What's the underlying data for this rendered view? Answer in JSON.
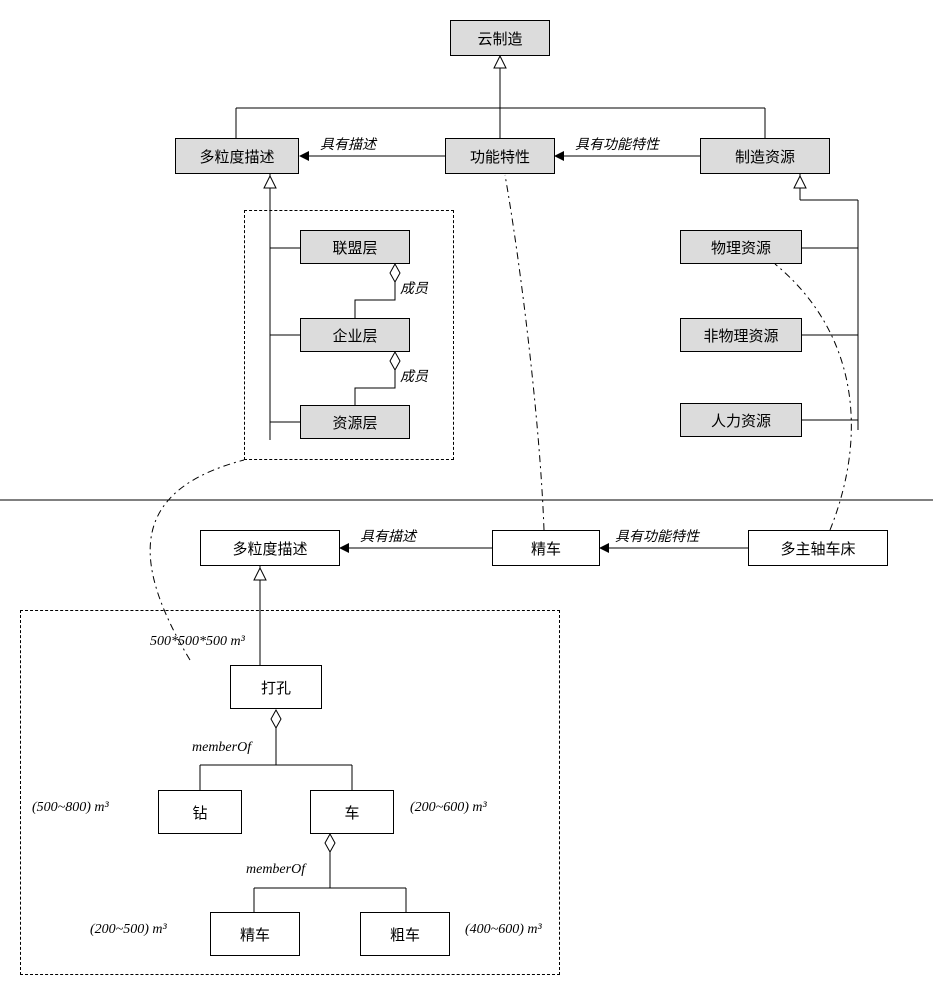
{
  "top": {
    "root": "云制造",
    "multiGran": "多粒度描述",
    "funcChar": "功能特性",
    "mfgRes": "制造资源",
    "r1_hasDesc": "具有描述",
    "r2_hasFunc": "具有功能特性",
    "layers": {
      "alliance": "联盟层",
      "enterprise": "企业层",
      "resource": "资源层",
      "member": "成员"
    },
    "resTypes": {
      "physical": "物理资源",
      "nonphysical": "非物理资源",
      "human": "人力资源"
    }
  },
  "bottom": {
    "multiGran": "多粒度描述",
    "fineTurn": "精车",
    "multiSpindle": "多主轴车床",
    "r_hasDesc": "具有描述",
    "r_hasFunc": "具有功能特性",
    "tree": {
      "drill": "打孔",
      "drillSpec": "500*500*500 m³",
      "memberOf": "memberOf",
      "boreDrill": "钻",
      "turn": "车",
      "boreSpec": "(500~800) m³",
      "turnSpec": "(200~600) m³",
      "fineTurn": "精车",
      "roughTurn": "粗车",
      "fineSpec": "(200~500) m³",
      "roughSpec": "(400~600) m³"
    }
  },
  "chart_data": {
    "type": "table",
    "note": "Ontology / class diagram for cloud manufacturing resources. Shaded boxes = classes (upper ontology). White boxes = instances (lower example). Hollow-triangle arrows = generalization (subclass-of / instance-of). Solid arrows with labels = named relations. Hollow diamonds = aggregation (memberOf). Dash-dot curves = instance-of links crossing the horizontal separator.",
    "generalizations": [
      [
        "多粒度描述",
        "云制造"
      ],
      [
        "功能特性",
        "云制造"
      ],
      [
        "制造资源",
        "云制造"
      ],
      [
        "联盟层",
        "多粒度描述"
      ],
      [
        "物理资源",
        "制造资源"
      ],
      [
        "非物理资源",
        "制造资源"
      ],
      [
        "人力资源",
        "制造资源"
      ],
      [
        "打孔 inst",
        "多粒度描述 inst"
      ]
    ],
    "relations": [
      {
        "from": "功能特性",
        "to": "多粒度描述",
        "label": "具有描述"
      },
      {
        "from": "制造资源",
        "to": "功能特性",
        "label": "具有功能特性"
      },
      {
        "from": "精车 inst",
        "to": "多粒度描述 inst",
        "label": "具有描述"
      },
      {
        "from": "多主轴车床",
        "to": "精车 inst",
        "label": "具有功能特性"
      }
    ],
    "aggregations": [
      {
        "whole": "联盟层",
        "part": "企业层",
        "label": "成员"
      },
      {
        "whole": "企业层",
        "part": "资源层",
        "label": "成员"
      },
      {
        "whole": "打孔",
        "parts": [
          "钻",
          "车"
        ],
        "label": "memberOf"
      },
      {
        "whole": "车",
        "parts": [
          "精车",
          "粗车"
        ],
        "label": "memberOf"
      }
    ],
    "instanceOf": [
      {
        "instance": "打孔 subtree",
        "class": "联盟层/企业层/资源层 group"
      },
      {
        "instance": "精车 inst",
        "class": "功能特性"
      },
      {
        "instance": "多主轴车床",
        "class": "物理资源"
      }
    ],
    "capacities": {
      "打孔": "500*500*500 m³",
      "钻": "(500~800) m³",
      "车": "(200~600) m³",
      "精车": "(200~500) m³",
      "粗车": "(400~600) m³"
    }
  }
}
